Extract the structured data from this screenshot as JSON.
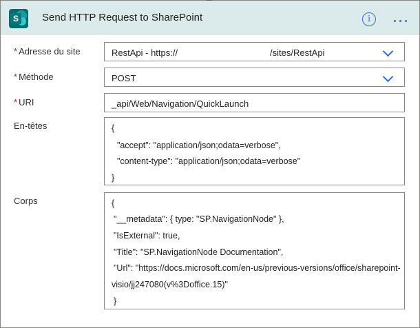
{
  "header": {
    "title": "Send HTTP Request to SharePoint",
    "logo_letter": "S"
  },
  "fields": {
    "site": {
      "label": "Adresse du site",
      "required": "*",
      "value_prefix": "RestApi - https://",
      "value_suffix": "/sites/RestApi"
    },
    "method": {
      "label": "Méthode",
      "required": "*",
      "value": "POST"
    },
    "uri": {
      "label": "URI",
      "required": "*",
      "value": "_api/Web/Navigation/QuickLaunch"
    },
    "headers": {
      "label": "En-têtes",
      "lines": [
        "{",
        "\"accept\": \"application/json;odata=verbose\",",
        "\"content-type\": \"application/json;odata=verbose\"",
        "}"
      ]
    },
    "body": {
      "label": "Corps",
      "lines": [
        "{",
        "\"__metadata\": { type: \"SP.NavigationNode\" },",
        "\"IsExternal\": true,",
        "\"Title\": \"SP.NavigationNode Documentation\",",
        "\"Url\": \"https://docs.microsoft.com/en-us/previous-versions/office/sharepoint-",
        "visio/jj247080(v%3Doffice.15)\"",
        "}"
      ]
    }
  },
  "icons": {
    "info": "info-icon",
    "more": "more-options-icon",
    "dropdown": "chevron-down-icon"
  },
  "colors": {
    "header_bg": "#dbeaea",
    "accent": "#2f6fd1",
    "required": "#a4262c",
    "sharepoint": "#036c70"
  }
}
